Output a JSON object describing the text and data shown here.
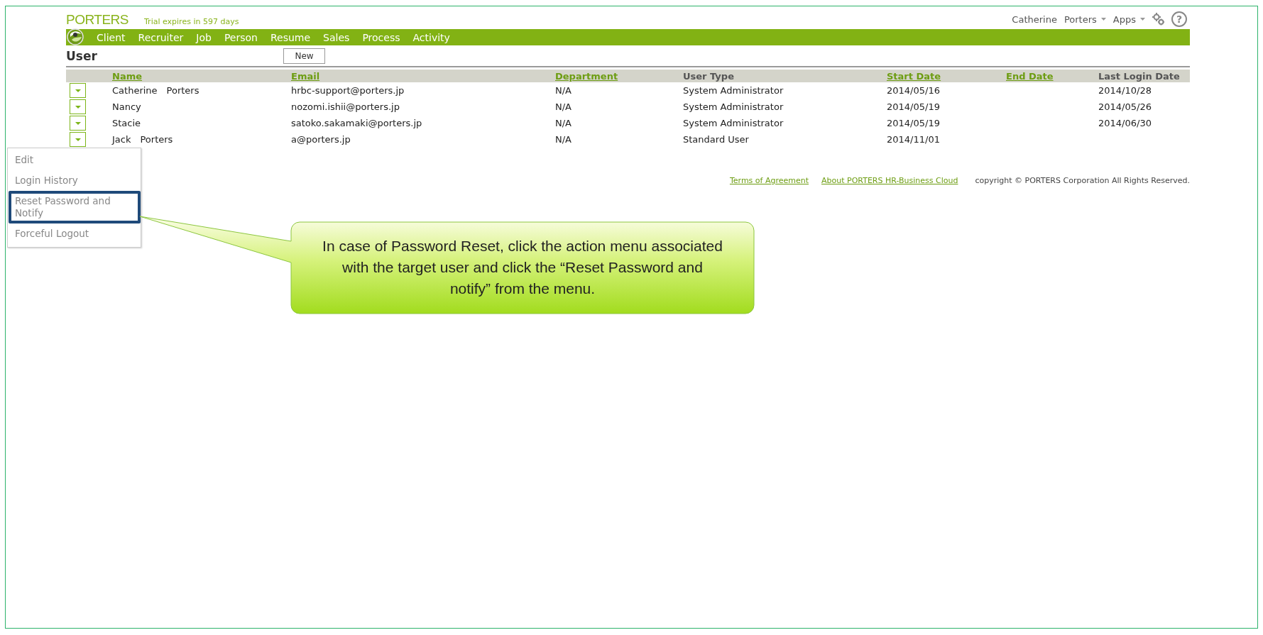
{
  "header": {
    "logo": "PORTERS",
    "trial": "Trial expires in 597 days",
    "user_menu": [
      {
        "label": "Catherine",
        "dropdown": false
      },
      {
        "label": "Porters",
        "dropdown": true
      },
      {
        "label": "Apps",
        "dropdown": true
      }
    ],
    "help": "?"
  },
  "nav": {
    "items": [
      "Client",
      "Recruiter",
      "Job",
      "Person",
      "Resume",
      "Sales",
      "Process",
      "Activity"
    ]
  },
  "page": {
    "title": "User",
    "new_button": "New"
  },
  "table": {
    "columns": [
      {
        "label": "Name",
        "sortable": true
      },
      {
        "label": "Email",
        "sortable": true
      },
      {
        "label": "Department",
        "sortable": true
      },
      {
        "label": "User Type",
        "sortable": false
      },
      {
        "label": "Start Date",
        "sortable": true
      },
      {
        "label": "End Date",
        "sortable": true
      },
      {
        "label": "Last Login Date",
        "sortable": false
      }
    ],
    "rows": [
      [
        "Catherine　Porters",
        "hrbc-support@porters.jp",
        "N/A",
        "System Administrator",
        "2014/05/16",
        "",
        "2014/10/28"
      ],
      [
        "Nancy",
        "nozomi.ishii@porters.jp",
        "N/A",
        "System Administrator",
        "2014/05/19",
        "",
        "2014/05/26"
      ],
      [
        "Stacie",
        "satoko.sakamaki@porters.jp",
        "N/A",
        "System Administrator",
        "2014/05/19",
        "",
        "2014/06/30"
      ],
      [
        "Jack　Porters",
        "a@porters.jp",
        "N/A",
        "Standard User",
        "2014/11/01",
        "",
        ""
      ]
    ]
  },
  "action_menu": {
    "items": [
      {
        "label": "Edit",
        "selected": false
      },
      {
        "label": "Login History",
        "selected": false
      },
      {
        "label": "Reset Password and Notify",
        "selected": true
      },
      {
        "label": "Forceful Logout",
        "selected": false
      }
    ]
  },
  "footer": {
    "links": [
      "Terms of Agreement",
      "About PORTERS HR-Business Cloud"
    ],
    "copyright": "copyright © PORTERS Corporation All Rights Reserved."
  },
  "callout": {
    "text": "In case of Password Reset, click the action menu associated with the target user and click the “Reset Password and notify” from the menu."
  }
}
